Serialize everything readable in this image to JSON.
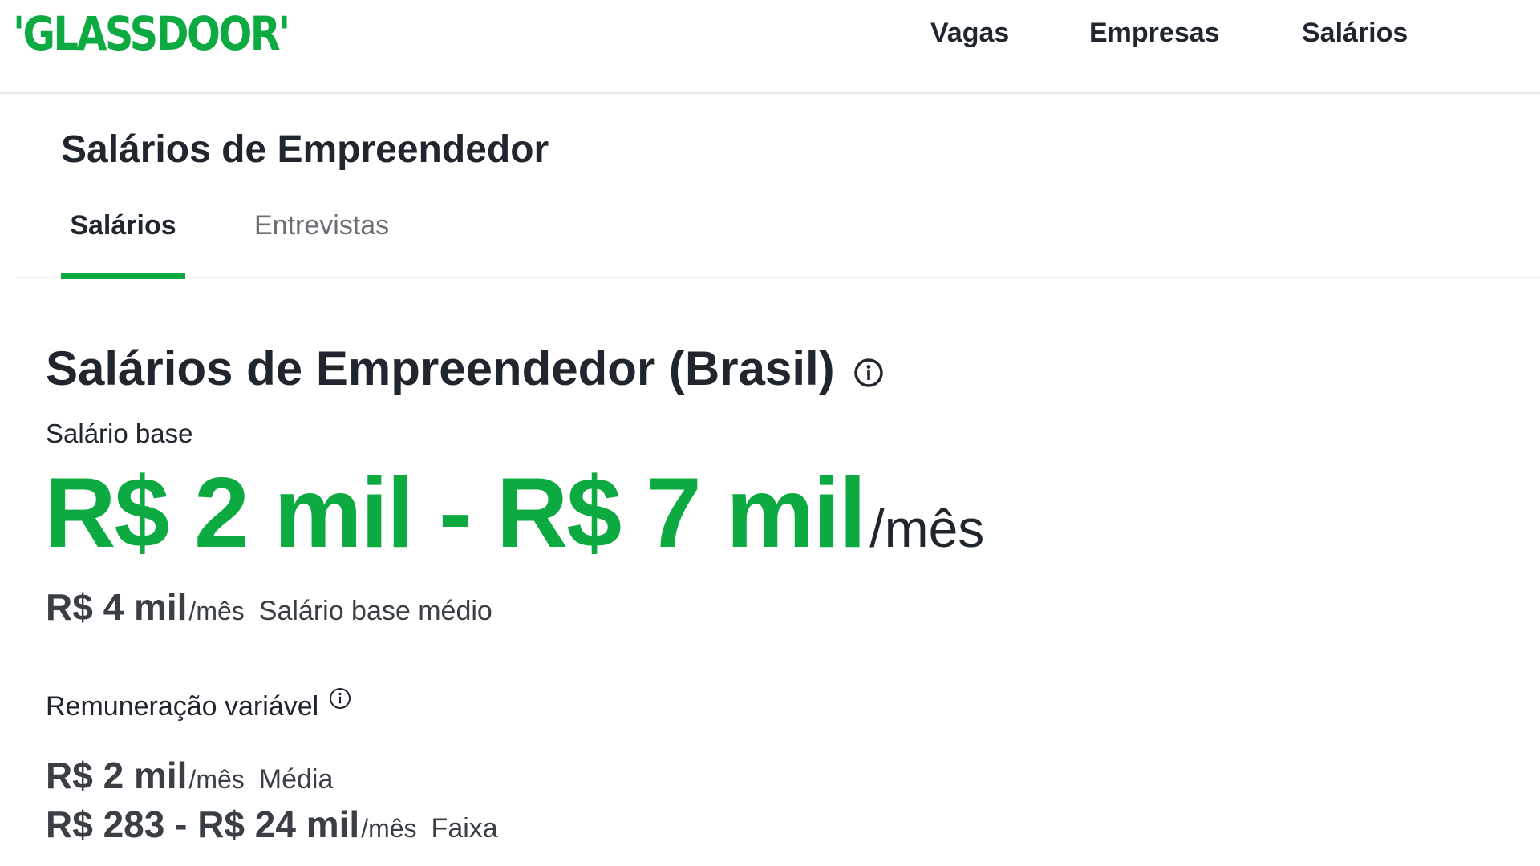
{
  "header": {
    "logo": "'GLASSDOOR'",
    "nav": {
      "vagas": "Vagas",
      "empresas": "Empresas",
      "salarios": "Salários"
    }
  },
  "occupation": {
    "title": "Salários de Empreendedor",
    "tabs": {
      "salarios": "Salários",
      "entrevistas": "Entrevistas"
    }
  },
  "main": {
    "title": "Salários de Empreendedor (Brasil)",
    "base": {
      "label": "Salário base",
      "range": "R$ 2 mil - R$ 7 mil",
      "range_unit": "/mês",
      "avg_value": "R$ 4 mil",
      "avg_unit": "/mês",
      "avg_label": "Salário base médio"
    },
    "variable": {
      "label": "Remuneração variável",
      "avg_value": "R$ 2 mil",
      "avg_unit": "/mês",
      "avg_label": "Média",
      "range_value": "R$ 283 - R$ 24 mil",
      "range_unit": "/mês",
      "range_label": "Faixa"
    }
  },
  "icons": {
    "title_info": "info-icon",
    "variable_info": "info-icon"
  },
  "colors": {
    "brand_green": "#0caa41",
    "text_dark": "#20262e",
    "tab_inactive": "#6b6f74",
    "divider": "#e6e6e6"
  }
}
